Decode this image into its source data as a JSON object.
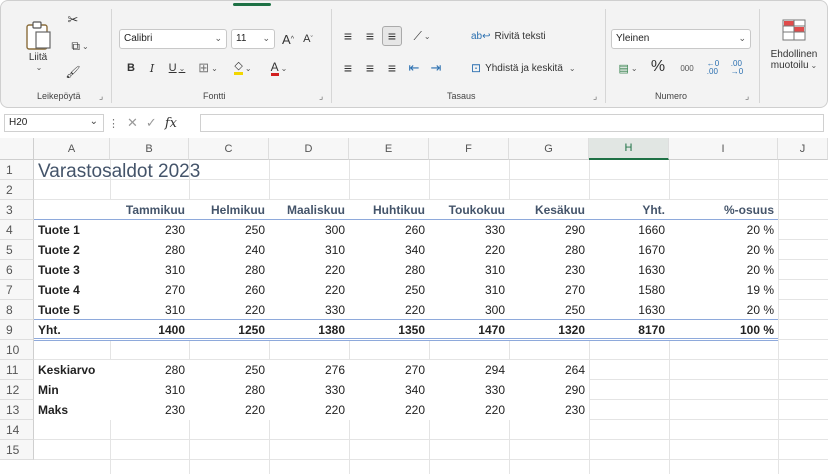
{
  "ribbon": {
    "clipboard": {
      "paste_label": "Liitä",
      "group_label": "Leikepöytä"
    },
    "font": {
      "name": "Calibri",
      "size": "11",
      "group_label": "Fontti",
      "bold": "B",
      "italic": "I",
      "underline": "U",
      "grow": "A",
      "shrink": "A",
      "color_a": "A"
    },
    "alignment": {
      "wrap_label": "Rivitä teksti",
      "merge_label": "Yhdistä ja keskitä",
      "group_label": "Tasaus"
    },
    "number": {
      "format": "Yleinen",
      "percent": "%",
      "thousands": "000",
      "group_label": "Numero"
    },
    "styles": {
      "conditional_line1": "Ehdollinen",
      "conditional_line2": "muotoilu"
    }
  },
  "formula_bar": {
    "name_box": "H20",
    "fx": "fx",
    "value": ""
  },
  "columns": [
    "A",
    "B",
    "C",
    "D",
    "E",
    "F",
    "G",
    "H",
    "I",
    "J"
  ],
  "selected_column": "H",
  "rows": [
    "1",
    "2",
    "3",
    "4",
    "5",
    "6",
    "7",
    "8",
    "9",
    "10",
    "11",
    "12",
    "13",
    "14",
    "15"
  ],
  "sheet": {
    "title": "Varastosaldot 2023",
    "headers": [
      "Tammikuu",
      "Helmikuu",
      "Maaliskuu",
      "Huhtikuu",
      "Toukokuu",
      "Kesäkuu",
      "Yht.",
      "%-osuus"
    ],
    "products": [
      {
        "name": "Tuote 1",
        "values": [
          "230",
          "250",
          "300",
          "260",
          "330",
          "290",
          "1660",
          "20 %"
        ]
      },
      {
        "name": "Tuote 2",
        "values": [
          "280",
          "240",
          "310",
          "340",
          "220",
          "280",
          "1670",
          "20 %"
        ]
      },
      {
        "name": "Tuote 3",
        "values": [
          "310",
          "280",
          "220",
          "280",
          "310",
          "230",
          "1630",
          "20 %"
        ]
      },
      {
        "name": "Tuote 4",
        "values": [
          "270",
          "260",
          "220",
          "250",
          "310",
          "270",
          "1580",
          "19 %"
        ]
      },
      {
        "name": "Tuote 5",
        "values": [
          "310",
          "220",
          "330",
          "220",
          "300",
          "250",
          "1630",
          "20 %"
        ]
      }
    ],
    "total": {
      "name": "Yht.",
      "values": [
        "1400",
        "1250",
        "1380",
        "1350",
        "1470",
        "1320",
        "8170",
        "100 %"
      ]
    },
    "stats": [
      {
        "name": "Keskiarvo",
        "values": [
          "280",
          "250",
          "276",
          "270",
          "294",
          "264"
        ]
      },
      {
        "name": "Min",
        "values": [
          "310",
          "280",
          "330",
          "340",
          "330",
          "290"
        ]
      },
      {
        "name": "Maks",
        "values": [
          "230",
          "220",
          "220",
          "220",
          "220",
          "230"
        ]
      }
    ]
  },
  "colors": {
    "accent": "#1e7145",
    "header_text": "#44546a",
    "rule": "#8ea9db"
  }
}
